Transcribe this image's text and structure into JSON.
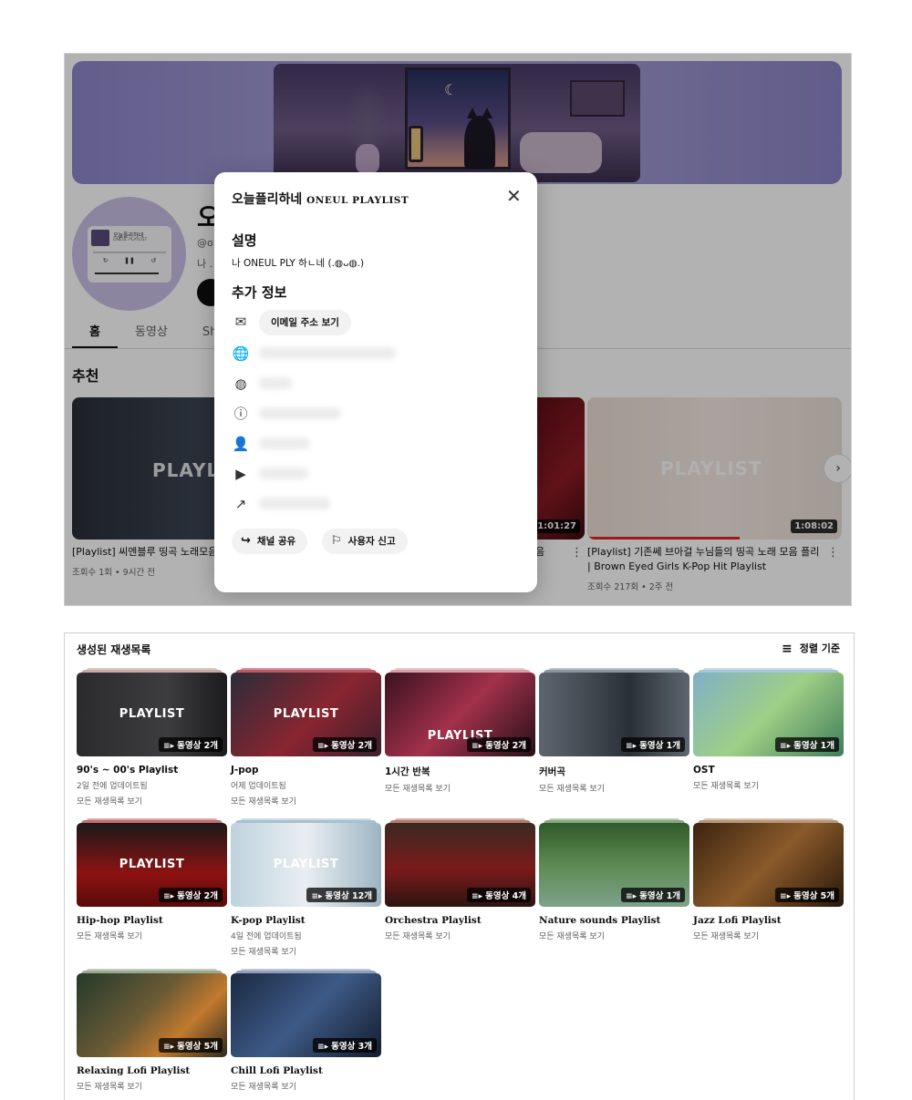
{
  "channel": {
    "name_fragment": "오",
    "handle_fragment": "@o",
    "desc_fragment": "나 ."
  },
  "tabs": [
    "홈",
    "동영상",
    "Shorts"
  ],
  "recommended": {
    "title": "추천",
    "videos": [
      {
        "title": "[Playlist] 씨엔블루 띵곡 노래모음",
        "meta": "조회수 1회 • 9시간 전",
        "duration": ""
      },
      {
        "title": "음",
        "meta": "",
        "duration": "1:01:27"
      },
      {
        "title": "[Playlist] 기존쎄 브아걸 누님들의 띵곡 노래 모음 플리 | Brown Eyed Girls K-Pop Hit Playlist",
        "title_line1": "[Playlist] 기존쎄 브아걸 누님들의 띵곡 노래 모음 플리",
        "title_line2": "| Brown Eyed Girls K-Pop Hit Playlist",
        "meta": "조회수 217회 • 2주 전",
        "duration": "1:08:02"
      }
    ],
    "thumb_word": "PLAYLIST"
  },
  "modal": {
    "title_ko": "오늘플리하네",
    "title_en": "ONEUL PLAYLIST",
    "close_icon": "close-icon",
    "desc_heading": "설명",
    "desc_text": "나 ONEUL PLY 하ㄴ네 (.◍ᴗ◍.)",
    "info_heading": "추가 정보",
    "email_button": "이메일 주소 보기",
    "share_button": "채널 공유",
    "report_button": "사용자 신고"
  },
  "avatar": {
    "title": "오늘플리하네",
    "subtitle": "ONEUL PLAYLIST"
  },
  "playlists_section": {
    "title": "생성된 재생목록",
    "sort_label": "정렬 기준",
    "items": [
      {
        "name": "90's ~ 00's Playlist",
        "updated": "2일 전에 업데이트됨",
        "link": "모든 재생목록 보기",
        "count": "동영상 2개",
        "word": "PLAYLIST",
        "serif": false
      },
      {
        "name": "J-pop",
        "updated": "어제 업데이트됨",
        "link": "모든 재생목록 보기",
        "count": "동영상 2개",
        "word": "PLAYLIST",
        "serif": false
      },
      {
        "name": "1시간 반복",
        "updated": "",
        "link": "모든 재생목록 보기",
        "count": "동영상 2개",
        "word": "PLAYLIST",
        "serif": false
      },
      {
        "name": "커버곡",
        "updated": "",
        "link": "모든 재생목록 보기",
        "count": "동영상 1개",
        "word": "",
        "serif": false
      },
      {
        "name": "OST",
        "updated": "",
        "link": "모든 재생목록 보기",
        "count": "동영상 1개",
        "word": "",
        "serif": false
      },
      {
        "name": "Hip-hop Playlist",
        "updated": "",
        "link": "모든 재생목록 보기",
        "count": "동영상 2개",
        "word": "PLAYLIST",
        "serif": true
      },
      {
        "name": "K-pop Playlist",
        "updated": "4일 전에 업데이트됨",
        "link": "모든 재생목록 보기",
        "count": "동영상 12개",
        "word": "PLAYLIST",
        "serif": true
      },
      {
        "name": "Orchestra Playlist",
        "updated": "",
        "link": "모든 재생목록 보기",
        "count": "동영상 4개",
        "word": "",
        "serif": true
      },
      {
        "name": "Nature sounds Playlist",
        "updated": "",
        "link": "모든 재생목록 보기",
        "count": "동영상 1개",
        "word": "",
        "serif": true
      },
      {
        "name": "Jazz Lofi Playlist",
        "updated": "",
        "link": "모든 재생목록 보기",
        "count": "동영상 5개",
        "word": "",
        "serif": true
      },
      {
        "name": "Relaxing Lofi Playlist",
        "updated": "",
        "link": "모든 재생목록 보기",
        "count": "동영상 5개",
        "word": "",
        "serif": true
      },
      {
        "name": "Chill Lofi Playlist",
        "updated": "",
        "link": "모든 재생목록 보기",
        "count": "동영상 3개",
        "word": "",
        "serif": true
      }
    ]
  },
  "colors": {
    "banner": "#a59dd4",
    "overlay": "rgba(0,0,0,0.30)",
    "pill_bg": "#f2f2f2"
  }
}
